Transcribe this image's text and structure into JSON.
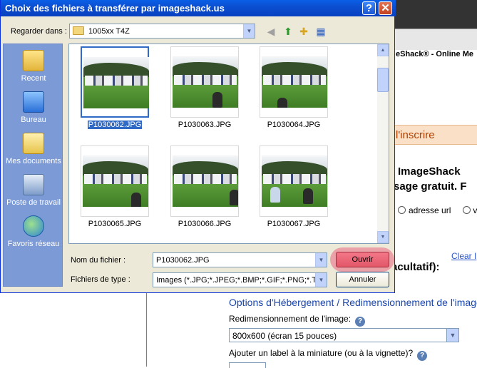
{
  "background_page": {
    "header_text": "eShack® - Online Me",
    "signup_text": "l'inscrire",
    "heading_line1": "ImageShack",
    "heading_line2": "sage gratuit. F",
    "radio_url_label": "adresse url",
    "radio_other_label": "v",
    "clear_link": "Clear I",
    "optional_label": "acultatif):",
    "options_heading": "Options d'Hébergement / Redimensionnement de l'image",
    "resize_label": "Redimensionnement de l'image:",
    "resize_value": "800x600 (écran 15 pouces)",
    "thumbnail_label": "Ajouter un label à la miniature (ou à la vignette)?",
    "help_icon": "question-icon"
  },
  "dialog": {
    "title": "Choix des fichiers à transférer par imageshack.us",
    "help_label": "?",
    "close_label": "✕",
    "look_in_label": "Regarder dans :",
    "look_in_value": "1005xx T4Z",
    "places": [
      {
        "label": "Recent",
        "icon": "recent-folder-icon"
      },
      {
        "label": "Bureau",
        "icon": "desktop-icon"
      },
      {
        "label": "Mes documents",
        "icon": "my-documents-icon"
      },
      {
        "label": "Poste de travail",
        "icon": "my-computer-icon"
      },
      {
        "label": "Favoris réseau",
        "icon": "network-places-icon"
      }
    ],
    "files": [
      {
        "name": "P1030062.JPG",
        "selected": true
      },
      {
        "name": "P1030063.JPG",
        "selected": false
      },
      {
        "name": "P1030064.JPG",
        "selected": false
      },
      {
        "name": "P1030065.JPG",
        "selected": false
      },
      {
        "name": "P1030066.JPG",
        "selected": false
      },
      {
        "name": "P1030067.JPG",
        "selected": false
      }
    ],
    "file_name_label": "Nom du fichier :",
    "file_name_value": "P1030062.JPG",
    "file_type_label": "Fichiers de type :",
    "file_type_value": "Images (*.JPG;*.JPEG;*.BMP;*.GIF;*.PNG;*.TIF",
    "open_label": "Ouvrir",
    "cancel_label": "Annuler"
  },
  "colors": {
    "titlebar": "#0b4fd1",
    "places_bar": "#7b9ad6",
    "selection": "#316ac5",
    "open_highlight": "#e25768"
  }
}
